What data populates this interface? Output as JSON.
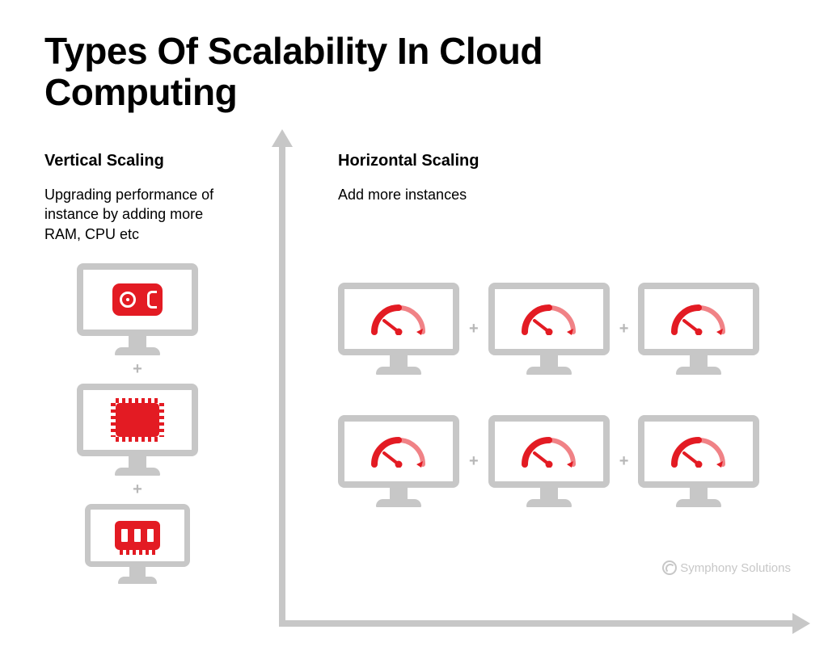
{
  "title_line1": "Types Of Scalability In Cloud",
  "title_line2": "Computing",
  "vertical": {
    "heading": "Vertical Scaling",
    "desc": "Upgrading performance of instance by adding more RAM, CPU etc",
    "plus": "+"
  },
  "horizontal": {
    "heading": "Horizontal Scaling",
    "desc": "Add more instances",
    "plus": "+"
  },
  "brand": "Symphony Solutions",
  "colors": {
    "accent": "#e31b23",
    "axis": "#c7c7c7"
  }
}
